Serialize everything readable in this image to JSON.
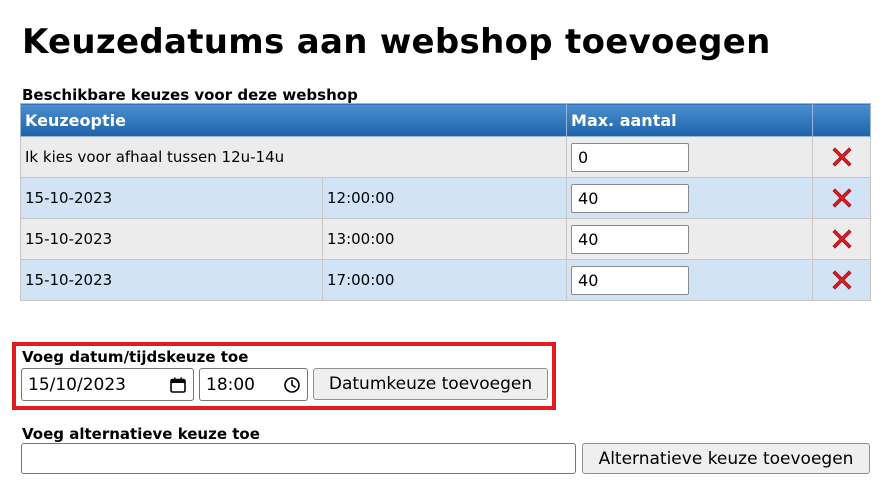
{
  "page": {
    "title": "Keuzedatums aan webshop toevoegen"
  },
  "choices": {
    "caption": "Beschikbare keuzes voor deze webshop",
    "headers": {
      "option": "Keuzeoptie",
      "max": "Max. aantal"
    },
    "rows": [
      {
        "option": "Ik kies voor afhaal tussen 12u-14u",
        "time": "",
        "max": "0"
      },
      {
        "option": "15-10-2023",
        "time": "12:00:00",
        "max": "40"
      },
      {
        "option": "15-10-2023",
        "time": "13:00:00",
        "max": "40"
      },
      {
        "option": "15-10-2023",
        "time": "17:00:00",
        "max": "40"
      }
    ],
    "delete_icon": "delete-x-icon",
    "delete_color": "#e01b22"
  },
  "add_date": {
    "label": "Voeg datum/tijdskeuze toe",
    "date_value": "15/10/2023",
    "time_value": "18:00",
    "button": "Datumkeuze toevoegen",
    "highlight_color": "#e01b22"
  },
  "add_alt": {
    "label": "Voeg alternatieve keuze toe",
    "input_value": "",
    "button": "Alternatieve keuze toevoegen"
  },
  "colors": {
    "header_bg": "#2b74bd",
    "row_odd": "#ececec",
    "row_even": "#d2e3f5"
  }
}
